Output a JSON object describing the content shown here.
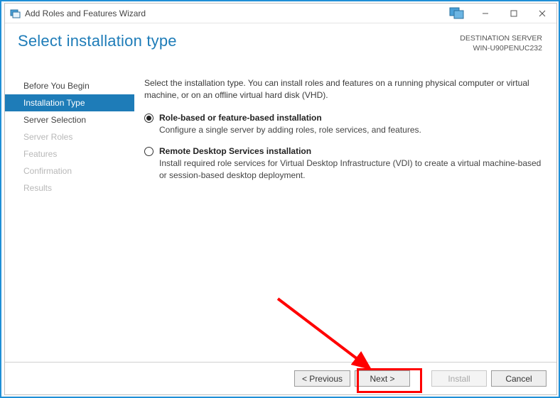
{
  "window": {
    "title": "Add Roles and Features Wizard"
  },
  "header": {
    "page_title": "Select installation type",
    "dest_label": "DESTINATION SERVER",
    "dest_value": "WIN-U90PENUC232"
  },
  "sidebar": {
    "steps": [
      {
        "label": "Before You Begin",
        "state": "normal"
      },
      {
        "label": "Installation Type",
        "state": "active"
      },
      {
        "label": "Server Selection",
        "state": "normal"
      },
      {
        "label": "Server Roles",
        "state": "disabled"
      },
      {
        "label": "Features",
        "state": "disabled"
      },
      {
        "label": "Confirmation",
        "state": "disabled"
      },
      {
        "label": "Results",
        "state": "disabled"
      }
    ]
  },
  "content": {
    "intro": "Select the installation type. You can install roles and features on a running physical computer or virtual machine, or on an offline virtual hard disk (VHD).",
    "options": [
      {
        "title": "Role-based or feature-based installation",
        "desc": "Configure a single server by adding roles, role services, and features.",
        "checked": true
      },
      {
        "title": "Remote Desktop Services installation",
        "desc": "Install required role services for Virtual Desktop Infrastructure (VDI) to create a virtual machine-based or session-based desktop deployment.",
        "checked": false
      }
    ]
  },
  "footer": {
    "previous": "< Previous",
    "next": "Next >",
    "install": "Install",
    "cancel": "Cancel"
  }
}
